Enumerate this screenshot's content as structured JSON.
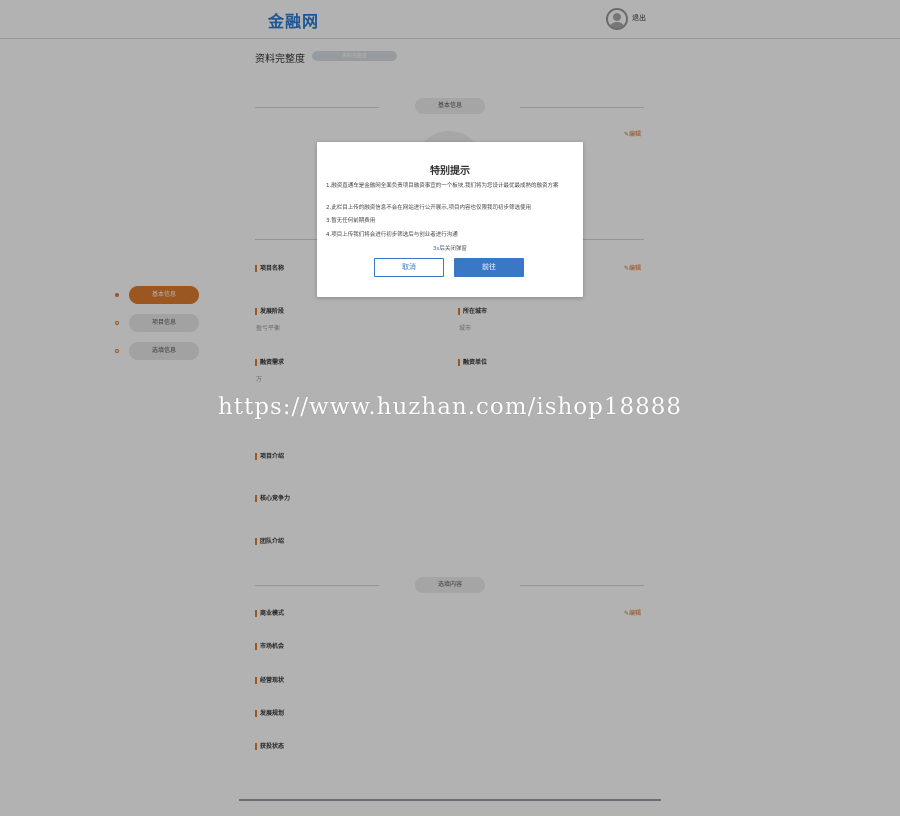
{
  "header": {
    "logo": "金融网",
    "logout": "退出"
  },
  "profile": {
    "completeness_label": "资料完整度",
    "completeness_value": "资料完整度"
  },
  "sections": {
    "basic": "基本信息",
    "optional": "选填内容",
    "edit": "编辑"
  },
  "sidebar": {
    "items": [
      {
        "label": "基本信息",
        "active": true
      },
      {
        "label": "项目信息",
        "active": false
      },
      {
        "label": "选填信息",
        "active": false
      }
    ]
  },
  "fields": {
    "project_name": "项目名称",
    "stage": "发展阶段",
    "stage_value": "盈亏平衡",
    "city": "所在城市",
    "city_value": "城市",
    "demand": "融资需求",
    "demand_value": "万",
    "unit": "融资单位",
    "intro": "项目介绍",
    "core": "核心竞争力",
    "team": "团队介绍",
    "model": "商业模式",
    "market": "市场机会",
    "operation": "经营现状",
    "plan": "发展规划",
    "financing_status": "获投状态"
  },
  "modal": {
    "title": "特别提示",
    "lines": [
      "1.融资直通车是金融网全面负责项目融资事宜的一个板块,我们将为您设计最优最成熟的融资方案",
      "2.此栏目上传的融资信息不会在网站进行公开展示,项目内容也仅限我司初步筛选使用",
      "3.暂无任何前期费用",
      "4.项目上传我们将会进行初步筛选后与创业者进行沟通"
    ],
    "countdown_num": "3s",
    "countdown_text": "后关闭弹窗",
    "cancel": "取消",
    "go": "前往"
  },
  "watermark": "https://www.huzhan.com/ishop18888",
  "colors": {
    "accent_orange": "#e07b2d",
    "primary_blue": "#3a78c6",
    "logo_blue": "#2a7bd3"
  }
}
